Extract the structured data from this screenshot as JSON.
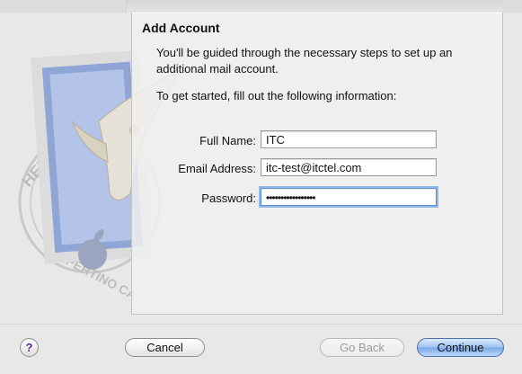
{
  "sheet": {
    "title": "Add Account",
    "intro": "You'll be guided through the necessary steps to set up an additional mail account.",
    "instruction": "To get started, fill out the following information:"
  },
  "form": {
    "full_name_label": "Full Name:",
    "full_name_value": "ITC",
    "email_label": "Email Address:",
    "email_value": "itc-test@itctel.com",
    "password_label": "Password:",
    "password_value": "•••••••••••••••••"
  },
  "buttons": {
    "help": "?",
    "cancel": "Cancel",
    "go_back": "Go Back",
    "continue": "Continue"
  },
  "stamp_text": {
    "top": "HELLO FR",
    "bottom": "CUPERTINO CA"
  },
  "colors": {
    "accent_blue": "#7ea9e6",
    "focus_ring": "#93b8ea",
    "help_glyph": "#5b2a8c"
  }
}
